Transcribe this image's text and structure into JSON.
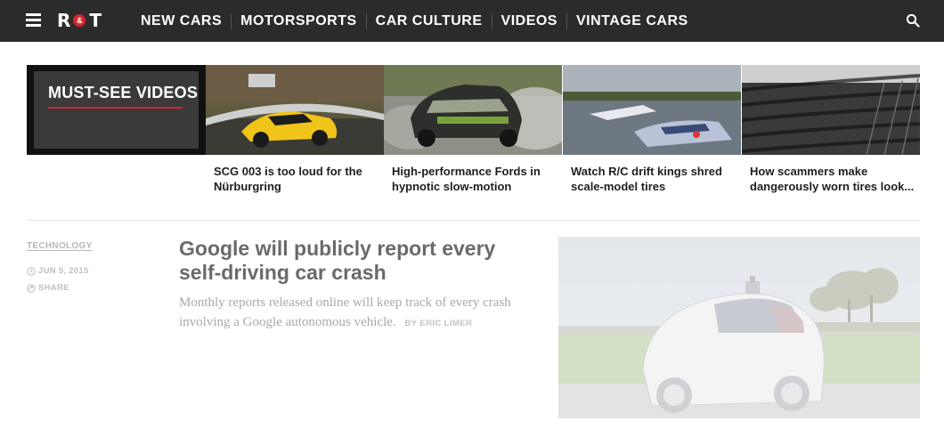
{
  "header": {
    "logo_left": "R",
    "logo_mid": "&",
    "logo_right": "T",
    "nav": [
      {
        "label": "NEW CARS"
      },
      {
        "label": "MOTORSPORTS"
      },
      {
        "label": "CAR CULTURE"
      },
      {
        "label": "VIDEOS"
      },
      {
        "label": "VINTAGE CARS"
      }
    ],
    "icons": {
      "menu": "hamburger-icon",
      "search": "search-icon"
    }
  },
  "videos": {
    "heading": "MUST-SEE VIDEOS",
    "items": [
      {
        "title": "SCG 003 is too loud for the Nürburgring"
      },
      {
        "title": "High-performance Fords in hypnotic slow-motion"
      },
      {
        "title": "Watch R/C drift kings shred scale-model tires"
      },
      {
        "title": "How scammers make dangerously worn tires look..."
      }
    ]
  },
  "story": {
    "category": "TECHNOLOGY",
    "date": "JUN 5, 2015",
    "share": "SHARE",
    "headline": "Google will publicly report every self-driving car crash",
    "dek": "Monthly reports released online will keep track of every crash involving a Google autonomous vehicle.",
    "byline": "BY ERIC LIMER"
  },
  "colors": {
    "topbar": "#2b2b2b",
    "accent": "#d8242e"
  }
}
